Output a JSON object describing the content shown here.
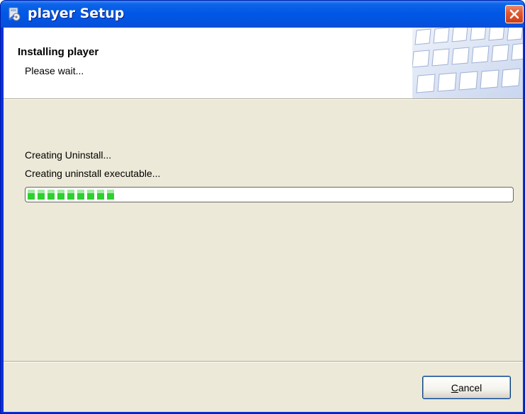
{
  "window": {
    "title": "player Setup",
    "titlebar_color": "#0058e6",
    "client_color": "#ece9d8"
  },
  "header": {
    "title": "Installing player",
    "subtitle": "Please wait..."
  },
  "progress": {
    "status": "Creating Uninstall...",
    "detail": "Creating uninstall executable...",
    "fraction": 0.19,
    "fill_color": "#2fd02f"
  },
  "buttons": {
    "cancel_mnemonic": "C",
    "cancel_rest": "ancel"
  },
  "icons": {
    "app": "setup-icon",
    "close": "close-icon",
    "banner": "keyboard-banner-image"
  }
}
